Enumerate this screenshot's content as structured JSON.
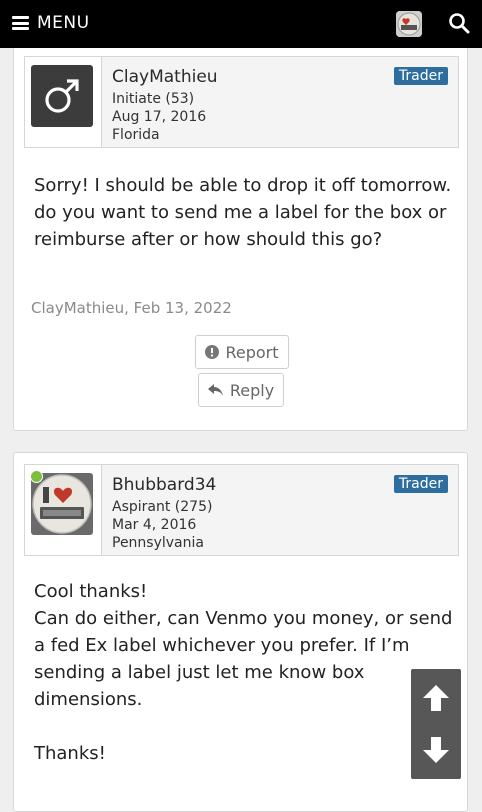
{
  "header": {
    "menu_label": "MENU"
  },
  "posts": [
    {
      "username": "ClayMathieu",
      "rank": "Initiate (53)",
      "joined": "Aug 17, 2016",
      "location": "Florida",
      "badge": "Trader",
      "message_lines": [
        "Sorry! I should be able to drop it off tomorrow. do you want to send me a label for the box or reimburse after or how should this go?"
      ],
      "footer": "ClayMathieu, Feb 13, 2022",
      "report_label": "Report",
      "reply_label": "Reply"
    },
    {
      "username": "Bhubbard34",
      "rank": "Aspirant (275)",
      "joined": "Mar 4, 2016",
      "location": "Pennsylvania",
      "badge": "Trader",
      "message_lines": [
        "Cool thanks!",
        "Can do either, can Venmo you money, or send a fed Ex label whichever you prefer. If I’m sending a label just let me know box dimensions.",
        "",
        "Thanks!"
      ]
    }
  ],
  "colors": {
    "badge": "#2e6e9e",
    "online": "#7bbf3c",
    "topbar": "#000000"
  }
}
